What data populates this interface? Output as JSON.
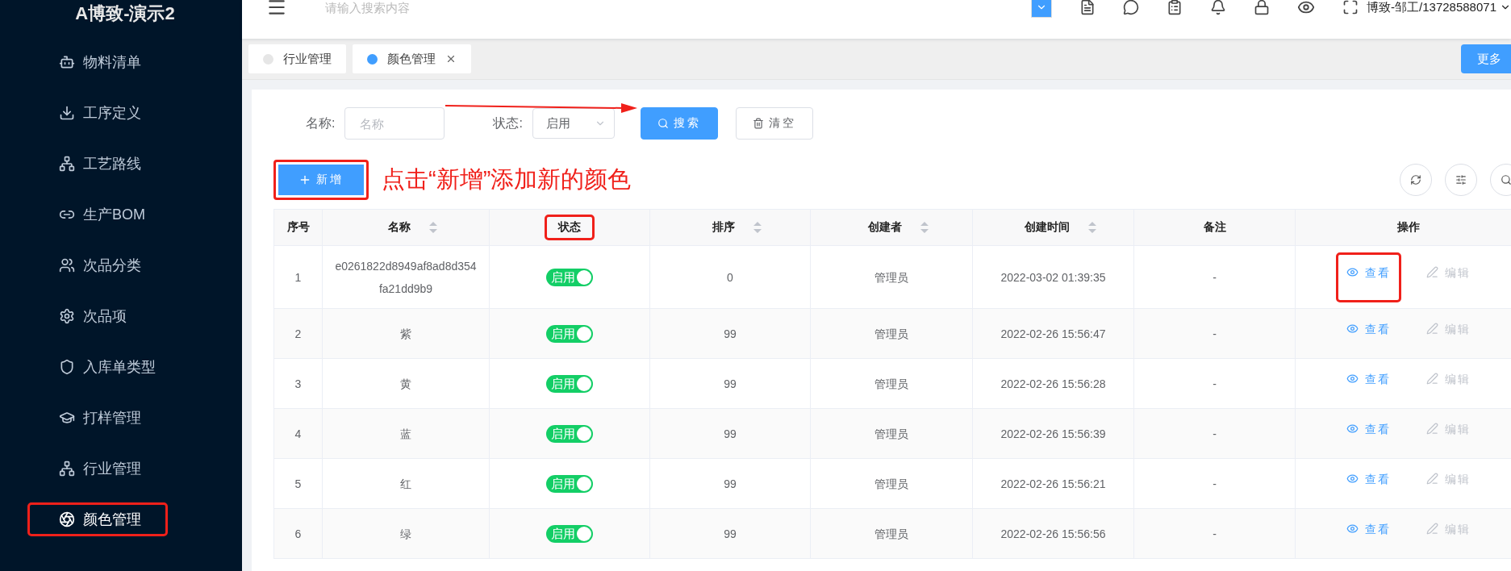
{
  "app_title": "A博致-演示2",
  "sidebar": {
    "items": [
      {
        "label": "物料清单",
        "selected": false,
        "annotated": false
      },
      {
        "label": "工序定义",
        "selected": false,
        "annotated": false
      },
      {
        "label": "工艺路线",
        "selected": false,
        "annotated": false
      },
      {
        "label": "生产BOM",
        "selected": false,
        "annotated": false
      },
      {
        "label": "次品分类",
        "selected": false,
        "annotated": false
      },
      {
        "label": "次品项",
        "selected": false,
        "annotated": false
      },
      {
        "label": "入库单类型",
        "selected": false,
        "annotated": false
      },
      {
        "label": "打样管理",
        "selected": false,
        "annotated": false
      },
      {
        "label": "行业管理",
        "selected": false,
        "annotated": false
      },
      {
        "label": "颜色管理",
        "selected": true,
        "annotated": true
      }
    ]
  },
  "header": {
    "search": {
      "placeholder": "请输入搜索内容"
    },
    "user": "博致-邹工/13728588071"
  },
  "tabs": [
    {
      "label": "行业管理",
      "selected": false,
      "closable": false
    },
    {
      "label": "颜色管理",
      "selected": true,
      "closable": true
    }
  ],
  "more_button": "更多",
  "filters": [
    {
      "kind": "input",
      "label": "名称:",
      "placeholder": "名称"
    },
    {
      "kind": "select",
      "label": "状态:",
      "value": "启用"
    }
  ],
  "search_button": "搜索",
  "clear_button": "清空",
  "add_button": {
    "label": "新增",
    "annotated": true
  },
  "annotation": {
    "text": "点击“新增”添加新的颜色"
  },
  "table": {
    "columns": [
      {
        "label": "序号",
        "sortable": false,
        "annotated": false
      },
      {
        "label": "名称",
        "sortable": true,
        "annotated": false
      },
      {
        "label": "状态",
        "sortable": false,
        "annotated": true
      },
      {
        "label": "排序",
        "sortable": true,
        "annotated": false
      },
      {
        "label": "创建者",
        "sortable": true,
        "annotated": false
      },
      {
        "label": "创建时间",
        "sortable": true,
        "annotated": false
      },
      {
        "label": "备注",
        "sortable": false,
        "annotated": false
      },
      {
        "label": "操作",
        "sortable": false,
        "annotated": false
      }
    ],
    "rows": [
      {
        "index": "1",
        "name": "e0261822d8949af8ad8d354fa21dd9b9",
        "status": {
          "label": "启用",
          "on": true
        },
        "order": "0",
        "creator": "管理员",
        "created": "2022-03-02 01:39:35",
        "note": "-",
        "actions": [
          {
            "kind": "view",
            "label": "查看",
            "annotated": true,
            "disabled": false
          },
          {
            "kind": "edit",
            "label": "编辑",
            "annotated": false,
            "disabled": true
          }
        ]
      },
      {
        "index": "2",
        "name": "紫",
        "status": {
          "label": "启用",
          "on": true
        },
        "order": "99",
        "creator": "管理员",
        "created": "2022-02-26 15:56:47",
        "note": "-",
        "actions": [
          {
            "kind": "view",
            "label": "查看",
            "annotated": false,
            "disabled": false
          },
          {
            "kind": "edit",
            "label": "编辑",
            "annotated": false,
            "disabled": true
          }
        ]
      },
      {
        "index": "3",
        "name": "黄",
        "status": {
          "label": "启用",
          "on": true
        },
        "order": "99",
        "creator": "管理员",
        "created": "2022-02-26 15:56:28",
        "note": "-",
        "actions": [
          {
            "kind": "view",
            "label": "查看",
            "annotated": false,
            "disabled": false
          },
          {
            "kind": "edit",
            "label": "编辑",
            "annotated": false,
            "disabled": true
          }
        ]
      },
      {
        "index": "4",
        "name": "蓝",
        "status": {
          "label": "启用",
          "on": true
        },
        "order": "99",
        "creator": "管理员",
        "created": "2022-02-26 15:56:39",
        "note": "-",
        "actions": [
          {
            "kind": "view",
            "label": "查看",
            "annotated": false,
            "disabled": false
          },
          {
            "kind": "edit",
            "label": "编辑",
            "annotated": false,
            "disabled": true
          }
        ]
      },
      {
        "index": "5",
        "name": "红",
        "status": {
          "label": "启用",
          "on": true
        },
        "order": "99",
        "creator": "管理员",
        "created": "2022-02-26 15:56:21",
        "note": "-",
        "actions": [
          {
            "kind": "view",
            "label": "查看",
            "annotated": false,
            "disabled": false
          },
          {
            "kind": "edit",
            "label": "编辑",
            "annotated": false,
            "disabled": true
          }
        ]
      },
      {
        "index": "6",
        "name": "绿",
        "status": {
          "label": "启用",
          "on": true
        },
        "order": "99",
        "creator": "管理员",
        "created": "2022-02-26 15:56:56",
        "note": "-",
        "actions": [
          {
            "kind": "view",
            "label": "查看",
            "annotated": false,
            "disabled": false
          },
          {
            "kind": "edit",
            "label": "编辑",
            "annotated": false,
            "disabled": true
          }
        ]
      }
    ]
  }
}
